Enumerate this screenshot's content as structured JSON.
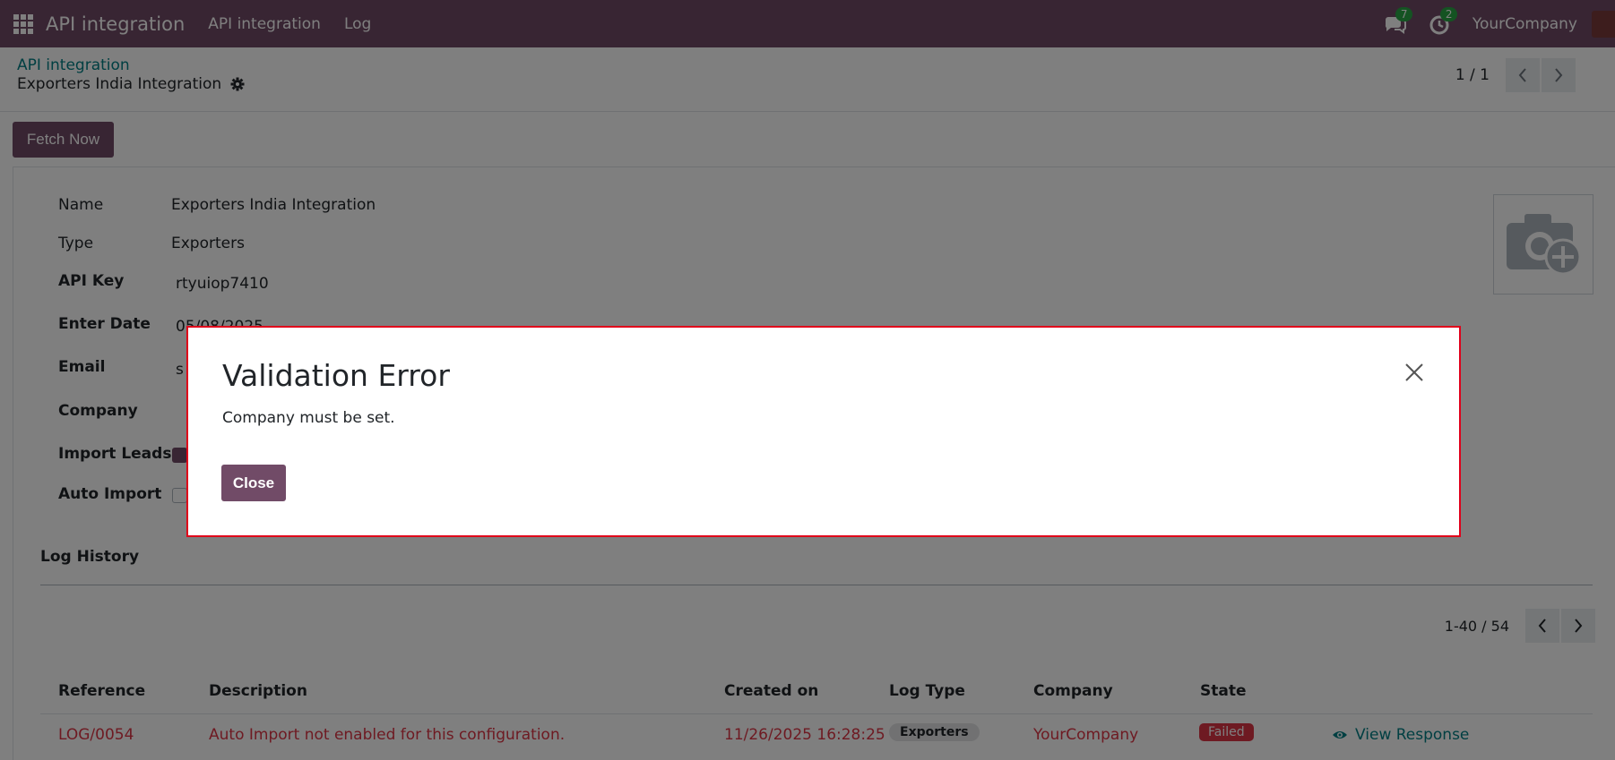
{
  "navbar": {
    "app_title": "API integration",
    "menu": [
      "API integration",
      "Log"
    ],
    "messages_badge": "7",
    "activities_badge": "2",
    "company": "YourCompany"
  },
  "control_panel": {
    "breadcrumb": "API integration",
    "record_title": "Exporters India Integration",
    "pager": "1 / 1"
  },
  "actions": {
    "fetch_now": "Fetch Now"
  },
  "form": {
    "name_label": "Name",
    "name_value": "Exporters India Integration",
    "type_label": "Type",
    "type_value": "Exporters",
    "api_key_label": "API Key",
    "api_key_value": "rtyuiop7410",
    "enter_date_label": "Enter Date",
    "enter_date_value": "05/08/2025",
    "email_label": "Email",
    "email_value": "s",
    "company_label": "Company",
    "import_leads_label": "Import Leads",
    "import_leads_checked": true,
    "auto_import_label": "Auto Import",
    "auto_import_checked": false
  },
  "log_history": {
    "title": "Log History",
    "pager": "1-40 / 54",
    "columns": [
      "Reference",
      "Description",
      "Created on",
      "Log Type",
      "Company",
      "State"
    ],
    "rows": [
      {
        "reference": "LOG/0054",
        "description": "Auto Import not enabled for this configuration.",
        "created_on": "11/26/2025 16:28:25",
        "log_type": "Exporters",
        "company": "YourCompany",
        "state": "Failed",
        "action": "View Response"
      }
    ]
  },
  "dialog": {
    "title": "Validation Error",
    "message": "Company must be set.",
    "close_label": "Close"
  }
}
